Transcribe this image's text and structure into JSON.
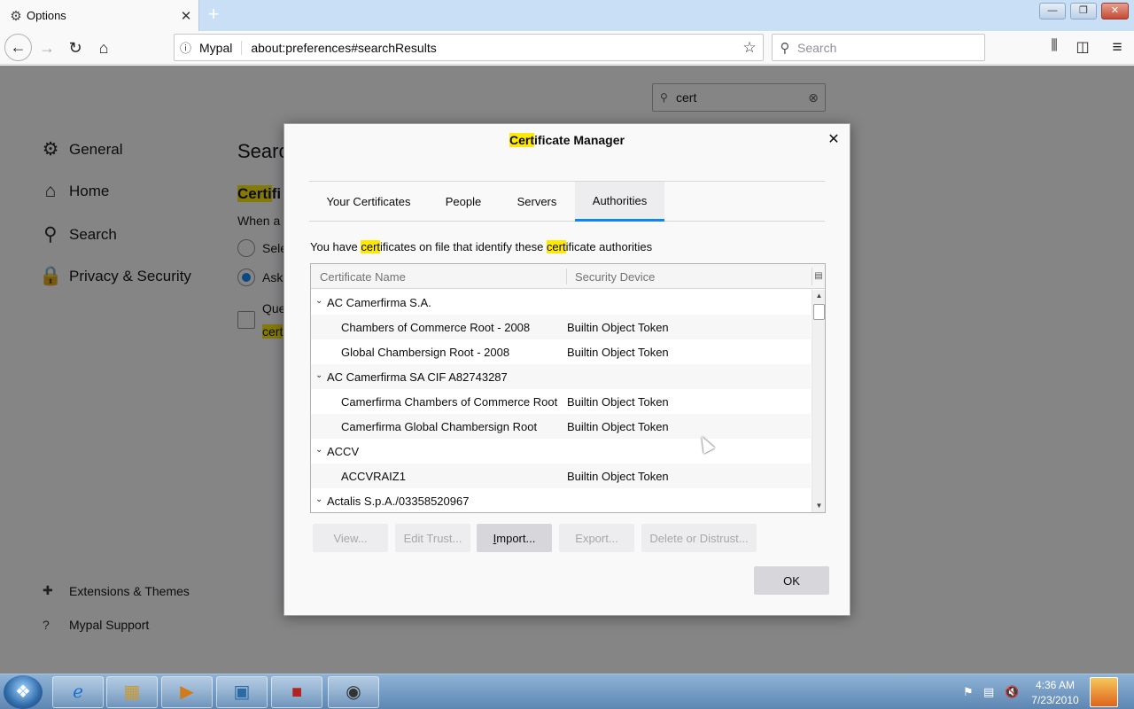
{
  "browser": {
    "tab_title": "Options",
    "tab_icon": "gear-icon",
    "new_tab": "+",
    "identity": "Mypal",
    "url": "about:preferences#searchResults",
    "search_placeholder": "Search"
  },
  "window_controls": {
    "minimize": "—",
    "maximize": "❐",
    "close": "✕"
  },
  "preferences": {
    "find_value": "cert",
    "categories": {
      "general": "General",
      "home": "Home",
      "search": "Search",
      "privacy": "Privacy & Security"
    },
    "links": {
      "extensions": "Extensions & Themes",
      "support": "Mypal Support"
    },
    "heading": "Searc",
    "subhead_hl": "Certi",
    "subhead_rest": "fi",
    "when_ask": "When a",
    "option_select": "Sele",
    "option_ask": "Ask",
    "query_label": "Que",
    "cert_label": "cert"
  },
  "dialog": {
    "title_hl": "Cert",
    "title_rest": "ificate Manager",
    "tabs": {
      "yours": "Your Certificates",
      "people": "People",
      "servers": "Servers",
      "authorities": "Authorities"
    },
    "desc": {
      "p1": "You have ",
      "hl1": "cert",
      "p2": "ificates on file that identify these ",
      "hl2": "cert",
      "p3": "ificate authorities"
    },
    "columns": {
      "name": "Certificate Name",
      "device": "Security Device"
    },
    "rows": [
      {
        "name": "AC Camerfirma S.A.",
        "device": ""
      },
      {
        "name": "Chambers of Commerce Root - 2008",
        "device": "Builtin Object Token"
      },
      {
        "name": "Global Chambersign Root - 2008",
        "device": "Builtin Object Token"
      },
      {
        "name": "AC Camerfirma SA CIF A82743287",
        "device": ""
      },
      {
        "name": "Camerfirma Chambers of Commerce Root",
        "device": "Builtin Object Token"
      },
      {
        "name": "Camerfirma Global Chambersign Root",
        "device": "Builtin Object Token"
      },
      {
        "name": "ACCV",
        "device": ""
      },
      {
        "name": "ACCVRAIZ1",
        "device": "Builtin Object Token"
      },
      {
        "name": "Actalis S.p.A./03358520967",
        "device": ""
      }
    ],
    "buttons": {
      "view": "View...",
      "edit_trust": "Edit Trust...",
      "import_accel": "I",
      "import_rest": "mport...",
      "export": "Export...",
      "delete": "Delete or Distrust...",
      "ok": "OK"
    }
  },
  "taskbar": {
    "time": "4:36 AM",
    "date": "7/23/2010"
  },
  "colors": {
    "accent": "#0a84ff",
    "highlight": "#ffe900",
    "overlay": "#0c0c0d"
  }
}
